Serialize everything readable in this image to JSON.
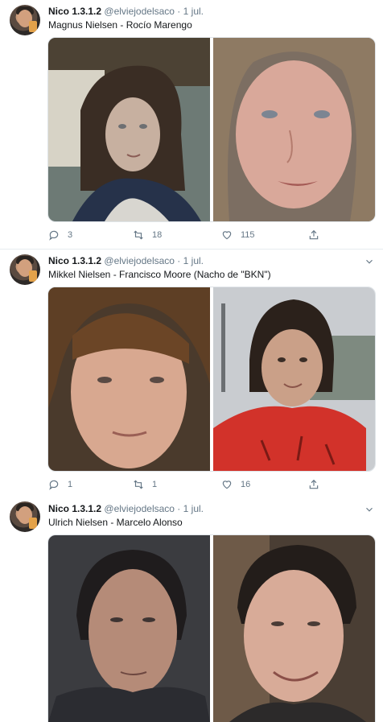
{
  "tweets": [
    {
      "author": {
        "name": "Nico 1.3.1.2",
        "handle": "@elviejodelsaco"
      },
      "separator": "·",
      "time": "1 jul.",
      "text": "Magnus Nielsen - Rocío Marengo",
      "images": [
        {
          "icon": "portrait-long-hair-man"
        },
        {
          "icon": "portrait-blonde-woman"
        }
      ],
      "actions": {
        "replies": "3",
        "retweets": "18",
        "likes": "115"
      }
    },
    {
      "author": {
        "name": "Nico 1.3.1.2",
        "handle": "@elviejodelsaco"
      },
      "separator": "·",
      "time": "1 jul.",
      "text": "Mikkel Nielsen - Francisco Moore (Nacho de \"BKN\")",
      "images": [
        {
          "icon": "portrait-boy"
        },
        {
          "icon": "portrait-teen-red-shirt"
        }
      ],
      "actions": {
        "replies": "1",
        "retweets": "1",
        "likes": "16"
      }
    },
    {
      "author": {
        "name": "Nico 1.3.1.2",
        "handle": "@elviejodelsaco"
      },
      "separator": "·",
      "time": "1 jul.",
      "text": "Ulrich Nielsen - Marcelo Alonso",
      "images": [
        {
          "icon": "portrait-man-dark-hair"
        },
        {
          "icon": "portrait-man-smiling"
        }
      ],
      "actions": {
        "replies": "",
        "retweets": "",
        "likes": ""
      }
    }
  ],
  "colors": {
    "accent": "#1da1f2",
    "muted": "#657786",
    "divider": "#e6ecf0",
    "thread": "#ccd6dd"
  }
}
